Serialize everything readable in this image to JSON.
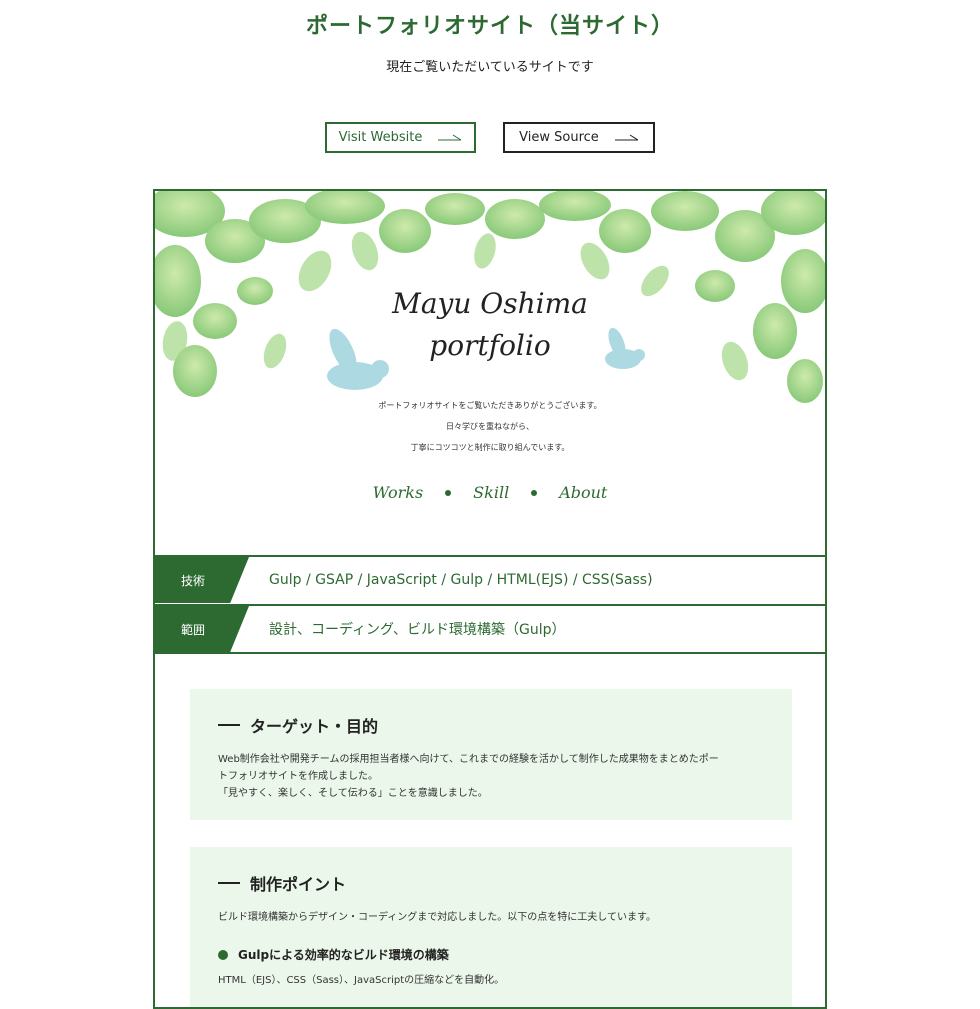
{
  "page": {
    "title": "ポートフォリオサイト（当サイト）",
    "subtitle": "現在ご覧いただいているサイトです"
  },
  "buttons": {
    "visit": "Visit Website",
    "source": "View Source"
  },
  "colors": {
    "accent": "#2d6a32",
    "panel_bg": "#eaf7ea"
  },
  "preview": {
    "brand_line1": "Mayu Oshima",
    "brand_line2": "portfolio",
    "intro": [
      "ポートフォリオサイトをご覧いただきありがとうございます。",
      "日々学びを重ねながら、",
      "丁寧にコツコツと制作に取り組んでいます。"
    ],
    "nav": [
      "Works",
      "Skill",
      "About"
    ]
  },
  "specs": [
    {
      "label": "技術",
      "value": "Gulp / GSAP / JavaScript / Gulp / HTML(EJS) / CSS(Sass)"
    },
    {
      "label": "範囲",
      "value": "設計、コーディング、ビルド環境構築（Gulp）"
    }
  ],
  "sections": {
    "target": {
      "heading": "ターゲット・目的",
      "lines": [
        "Web制作会社や開発チームの採用担当者様へ向けて、これまでの経験を活かして制作した成果物をまとめたポー",
        "トフォリオサイトを作成しました。",
        "「見やすく、楽しく、そして伝わる」ことを意識しました。"
      ]
    },
    "points": {
      "heading": "制作ポイント",
      "lead": "ビルド環境構築からデザイン・コーディングまで対応しました。以下の点を特に工夫しています。",
      "items": [
        {
          "title": "Gulpによる効率的なビルド環境の構築",
          "desc": "HTML（EJS）、CSS（Sass）、JavaScriptの圧縮などを自動化。"
        }
      ]
    }
  }
}
